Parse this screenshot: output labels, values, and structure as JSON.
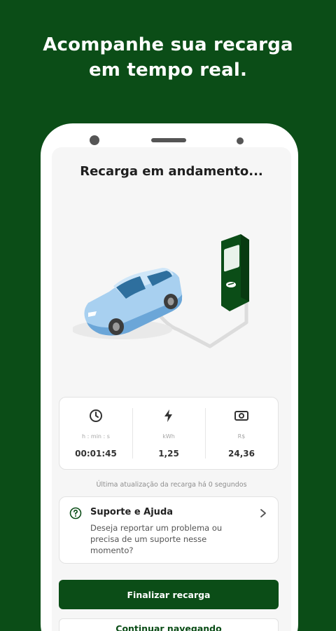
{
  "promo": {
    "line1": "Acompanhe sua recarga",
    "line2": "em tempo real."
  },
  "screen": {
    "title": "Recarga em andamento...",
    "stats": [
      {
        "icon": "clock-icon",
        "label": "h : min : s",
        "value": "00:01:45"
      },
      {
        "icon": "lightning-icon",
        "label": "kWh",
        "value": "1,25"
      },
      {
        "icon": "money-icon",
        "label": "R$",
        "value": "24,36"
      }
    ],
    "updated_text": "Última atualização da recarga há 0 segundos",
    "support": {
      "title": "Suporte e Ajuda",
      "description": "Deseja reportar um problema ou precisa de um suporte nesse momento?",
      "icon": "question-icon"
    },
    "primary_button": "Finalizar recarga",
    "secondary_button": "Continuar navegando"
  },
  "colors": {
    "background": "#0b4d17",
    "accent": "#0b4d17",
    "card": "#ffffff"
  }
}
